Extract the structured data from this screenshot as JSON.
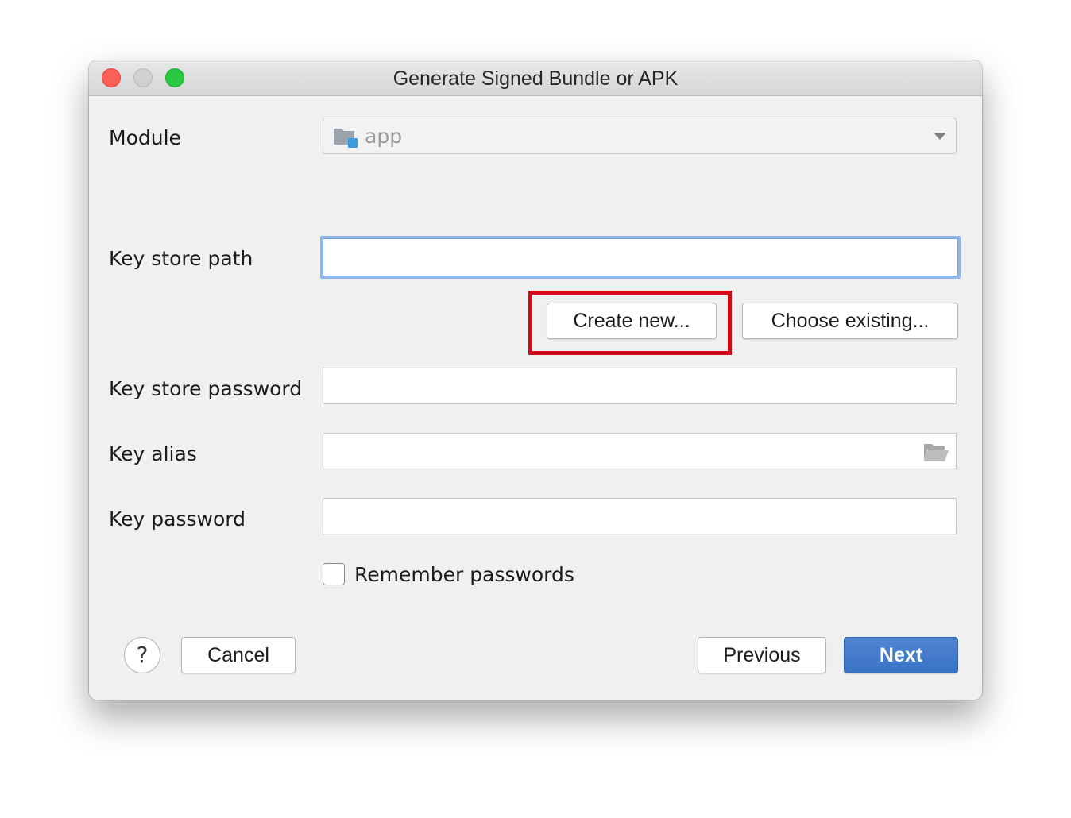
{
  "window": {
    "title": "Generate Signed Bundle or APK"
  },
  "module": {
    "label": "Module",
    "value": "app"
  },
  "key_store_path": {
    "label": "Key store path",
    "value": ""
  },
  "buttons": {
    "create_new": "Create new...",
    "choose_existing": "Choose existing...",
    "cancel": "Cancel",
    "previous": "Previous",
    "next": "Next",
    "help": "?"
  },
  "key_store_password": {
    "label": "Key store password",
    "value": ""
  },
  "key_alias": {
    "label": "Key alias",
    "value": ""
  },
  "key_password": {
    "label": "Key password",
    "value": ""
  },
  "remember_passwords": {
    "label": "Remember passwords",
    "checked": false
  },
  "icons": [
    "close-icon",
    "minimize-icon",
    "maximize-icon",
    "module-folder-icon",
    "chevron-down-icon",
    "folder-open-icon",
    "help-icon"
  ],
  "colors": {
    "accent": "#3a72c5",
    "highlight": "#d40a18",
    "focus_ring": "#8fb7ea"
  }
}
